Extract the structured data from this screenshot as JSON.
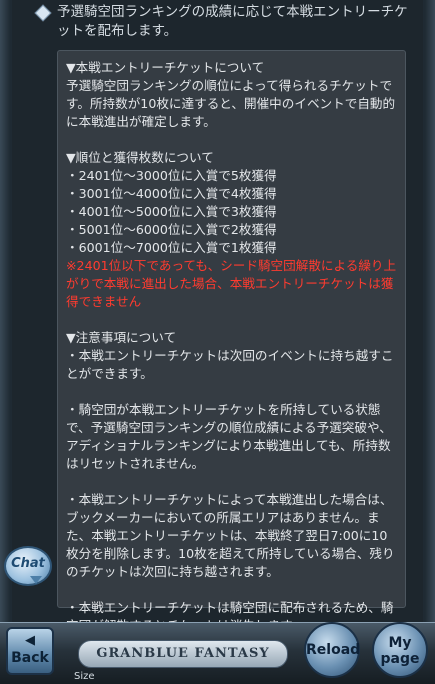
{
  "intro": "予選騎空団ランキングの成績に応じて本戦エントリーチケットを配布します。",
  "panel": {
    "sec1_title": "▼本戦エントリーチケットについて",
    "sec1_body": "予選騎空団ランキングの順位によって得られるチケットです。所持数が10枚に達すると、開催中のイベントで自動的に本戦進出が確定します。",
    "sec2_title": "▼順位と獲得枚数について",
    "ranks": [
      "・2401位～3000位に入賞で5枚獲得",
      "・3001位～4000位に入賞で4枚獲得",
      "・4001位～5000位に入賞で3枚獲得",
      "・5001位～6000位に入賞で2枚獲得",
      "・6001位～7000位に入賞で1枚獲得"
    ],
    "warning": "※2401位以下であっても、シード騎空団解散による繰り上がりで本戦に進出した場合、本戦エントリーチケットは獲得できません",
    "sec3_title": "▼注意事項について",
    "notes": [
      "・本戦エントリーチケットは次回のイベントに持ち越すことができます。",
      "・騎空団が本戦エントリーチケットを所持している状態で、予選騎空団ランキングの順位成績による予選突破や、アディショナルランキングにより本戦進出しても、所持数はリセットされません。",
      "・本戦エントリーチケットによって本戦進出した場合は、ブックメーカーにおいての所属エリアはありません。また、本戦エントリーチケットは、本戦終了翌日7:00に10枚分を削除します。10枚を超えて所持している場合、残りのチケットは次回に持ち越されます。",
      "・本戦エントリーチケットは騎空団に配布されるため、騎空団が解散するとチケットは消失します。"
    ]
  },
  "footer": {
    "chat_label": "Chat",
    "back_arrow": "◀",
    "back_label": "Back",
    "logo_text": "GRANBLUE FANTASY",
    "reload_label": "Reload",
    "mypage_l1": "My",
    "mypage_l2": "page",
    "size_label": "Size"
  }
}
